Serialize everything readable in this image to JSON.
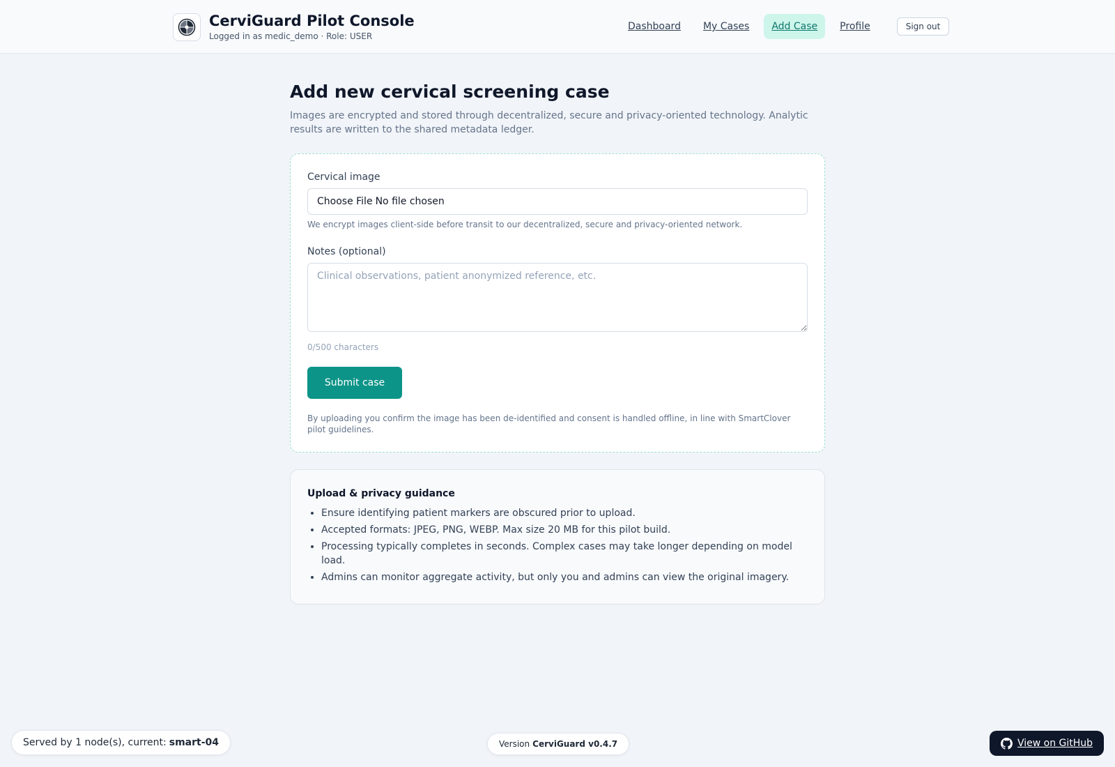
{
  "header": {
    "app_title": "CerviGuard Pilot Console",
    "subtitle": "Logged in as medic_demo · Role: USER",
    "nav": [
      {
        "label": "Dashboard",
        "active": false
      },
      {
        "label": "My Cases",
        "active": false
      },
      {
        "label": "Add Case",
        "active": true
      },
      {
        "label": "Profile",
        "active": false
      }
    ],
    "signout_label": "Sign out",
    "logo_icon": "aperture-icon"
  },
  "main": {
    "title": "Add new cervical screening case",
    "description": "Images are encrypted and stored through decentralized, secure and privacy-oriented technology. Analytic results are written to the shared metadata ledger.",
    "form": {
      "image_label": "Cervical image",
      "file_button": "Choose File",
      "file_status": "No file chosen",
      "image_hint": "We encrypt images client-side before transit to our decentralized, secure and privacy-oriented network.",
      "notes_label": "Notes (optional)",
      "notes_value": "",
      "notes_placeholder": "Clinical observations, patient anonymized reference, etc.",
      "char_counter": "0/500 characters",
      "submit_label": "Submit case",
      "consent": "By uploading you confirm the image has been de-identified and consent is handled offline, in line with SmartClover pilot guidelines."
    },
    "guidance": {
      "title": "Upload & privacy guidance",
      "items": [
        "Ensure identifying patient markers are obscured prior to upload.",
        "Accepted formats: JPEG, PNG, WEBP. Max size 20 MB for this pilot build.",
        "Processing typically completes in seconds. Complex cases may take longer depending on model load.",
        "Admins can monitor aggregate activity, but only you and admins can view the original imagery."
      ]
    }
  },
  "footer": {
    "node_prefix": "Served by 1 node(s), current:",
    "node_name": "smart-04",
    "version_prefix": "Version",
    "version_value": "CerviGuard v0.4.7",
    "github_label": "View on GitHub",
    "github_icon": "github-icon"
  },
  "colors": {
    "accent": "#0d9488",
    "active_nav_bg": "#cdf5ea",
    "page_bg": "#f1f4f8",
    "dark_button": "#0f172a"
  }
}
